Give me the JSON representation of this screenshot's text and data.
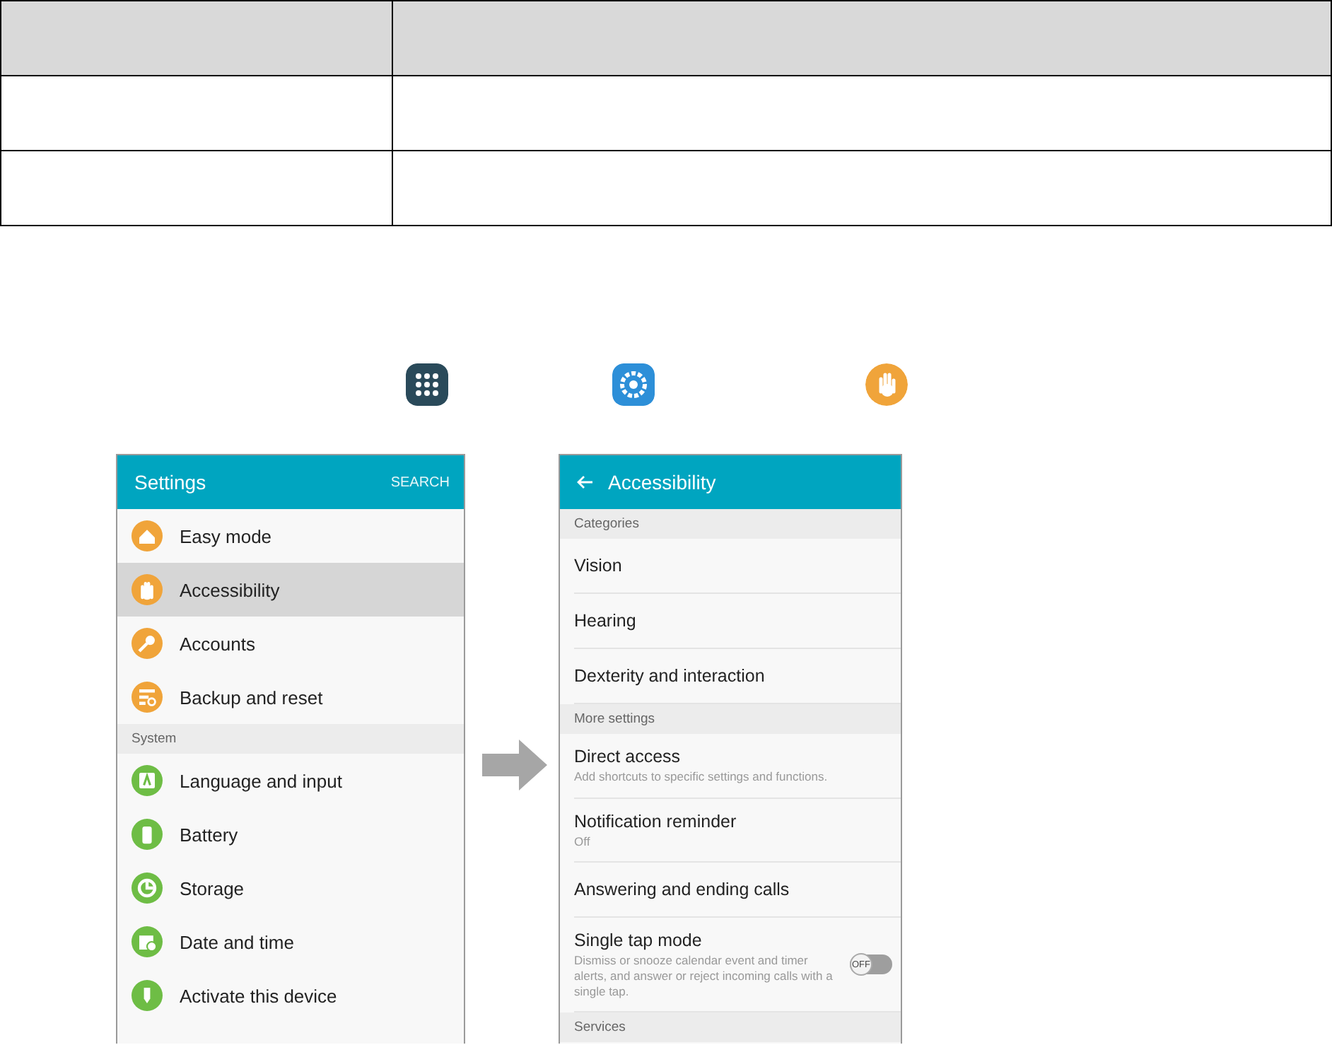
{
  "settings_screen": {
    "title": "Settings",
    "search": "SEARCH",
    "items": [
      {
        "kind": "item",
        "label": "Easy mode",
        "color": "#f0a43a",
        "selected": false
      },
      {
        "kind": "item",
        "label": "Accessibility",
        "color": "#f0a43a",
        "selected": true
      },
      {
        "kind": "item",
        "label": "Accounts",
        "color": "#f0a43a",
        "selected": false
      },
      {
        "kind": "item",
        "label": "Backup and reset",
        "color": "#f0a43a",
        "selected": false
      },
      {
        "kind": "section",
        "label": "System"
      },
      {
        "kind": "item",
        "label": "Language and input",
        "color": "#6ebd45",
        "selected": false
      },
      {
        "kind": "item",
        "label": "Battery",
        "color": "#6ebd45",
        "selected": false
      },
      {
        "kind": "item",
        "label": "Storage",
        "color": "#6ebd45",
        "selected": false
      },
      {
        "kind": "item",
        "label": "Date and time",
        "color": "#6ebd45",
        "selected": false
      },
      {
        "kind": "item",
        "label": "Activate this device",
        "color": "#6ebd45",
        "selected": false
      }
    ]
  },
  "accessibility_screen": {
    "title": "Accessibility",
    "items": [
      {
        "kind": "section",
        "label": "Categories"
      },
      {
        "kind": "item",
        "label": "Vision"
      },
      {
        "kind": "item",
        "label": "Hearing"
      },
      {
        "kind": "item",
        "label": "Dexterity and interaction"
      },
      {
        "kind": "section",
        "label": "More settings"
      },
      {
        "kind": "item",
        "label": "Direct access",
        "subtitle": "Add shortcuts to specific settings and functions."
      },
      {
        "kind": "item",
        "label": "Notification reminder",
        "subtitle": "Off"
      },
      {
        "kind": "item",
        "label": "Answering and ending calls"
      },
      {
        "kind": "toggle",
        "label": "Single tap mode",
        "subtitle": "Dismiss or snooze calendar event and timer alerts, and answer or reject incoming calls with a single tap.",
        "toggle_label": "OFF",
        "on": false
      },
      {
        "kind": "section",
        "label": "Services"
      }
    ]
  }
}
